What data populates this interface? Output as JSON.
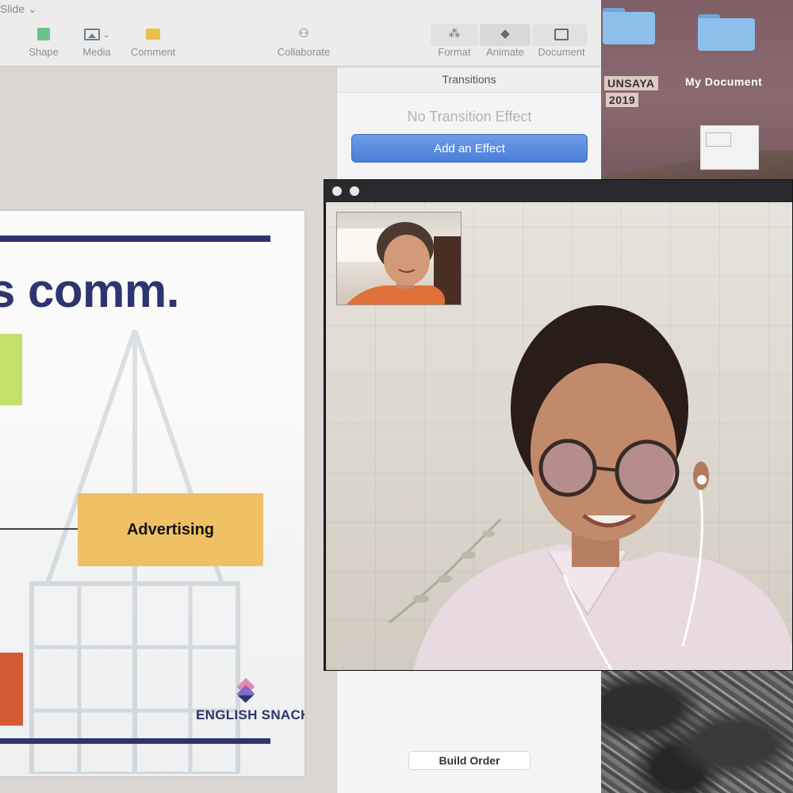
{
  "keynote": {
    "toolbar": {
      "title_partial": "Slide ⌄",
      "items": [
        {
          "label": "Shape",
          "icon": "shape-icon"
        },
        {
          "label": "Media",
          "icon": "media-icon"
        },
        {
          "label": "Comment",
          "icon": "comment-icon"
        },
        {
          "label": "Collaborate",
          "icon": "collaborate-icon"
        },
        {
          "label": "Format",
          "icon": "paintbrush-icon"
        },
        {
          "label": "Animate",
          "icon": "diamond-icon"
        },
        {
          "label": "Document",
          "icon": "document-icon"
        }
      ]
    },
    "inspector": {
      "header": "Transitions",
      "empty_text": "No Transition Effect",
      "add_button": "Add an Effect",
      "build_order_button": "Build Order"
    },
    "slide": {
      "title_partial": "s comm.",
      "box_label": "Advertising",
      "brand": "ENGLISH SNACK",
      "colors": {
        "navy": "#2e3470",
        "green": "#c2e06a",
        "orange": "#f0c064",
        "red": "#d35a32"
      }
    }
  },
  "desktop": {
    "items": [
      {
        "label": "UNSAYA 2019",
        "label_line1": "UNSAYA",
        "label_line2": "2019",
        "icon": "folder-icon"
      },
      {
        "label": "My Document",
        "icon": "folder-icon"
      },
      {
        "label": "",
        "icon": "document-thumbnail"
      }
    ]
  },
  "video_call": {
    "window_buttons": [
      "close",
      "minimize"
    ]
  }
}
